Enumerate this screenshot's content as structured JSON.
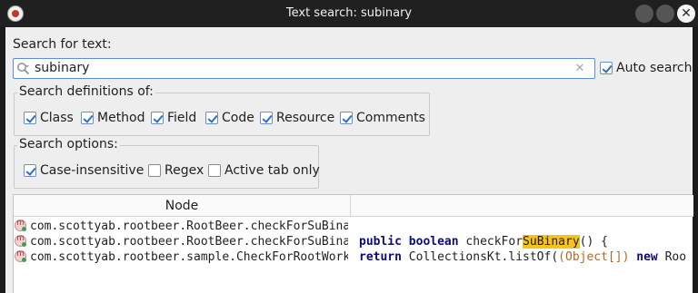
{
  "window": {
    "title": "Text search: subinary"
  },
  "search": {
    "label": "Search for text:",
    "value": "subinary",
    "auto_search_label": "Auto search",
    "auto_search_checked": true
  },
  "definitions": {
    "legend": "Search definitions of:",
    "items": [
      {
        "label": "Class",
        "checked": true
      },
      {
        "label": "Method",
        "checked": true
      },
      {
        "label": "Field",
        "checked": true
      },
      {
        "label": "Code",
        "checked": true
      },
      {
        "label": "Resource",
        "checked": true
      },
      {
        "label": "Comments",
        "checked": true
      }
    ]
  },
  "options": {
    "legend": "Search options:",
    "items": [
      {
        "label": "Case-insensitive",
        "checked": true
      },
      {
        "label": "Regex",
        "checked": false
      },
      {
        "label": "Active tab only",
        "checked": false
      }
    ]
  },
  "results": {
    "columns": [
      "Node",
      ""
    ],
    "rows": [
      {
        "node": "com.scottyab.rootbeer.RootBeer.checkForSuBinary",
        "code": {
          "k1": "",
          "k2": "",
          "pre": "",
          "hl": "",
          "post": ""
        }
      },
      {
        "node": "com.scottyab.rootbeer.RootBeer.checkForSuBinary",
        "code": {
          "k1": "public",
          "k2": "boolean",
          "pre": "checkFor",
          "hl": "SuBinary",
          "post": "() {"
        }
      },
      {
        "node": "com.scottyab.rootbeer.sample.CheckForRootWorker",
        "code": {
          "k1": "return",
          "pre2": "CollectionsKt.listOf(",
          "paren": "(Object[])",
          "k3": "new",
          "post2": "Roo"
        }
      }
    ]
  },
  "colors": {
    "accent": "#2f6ec8",
    "highlight": "#f6c31a",
    "keyword": "#0a0a80"
  }
}
